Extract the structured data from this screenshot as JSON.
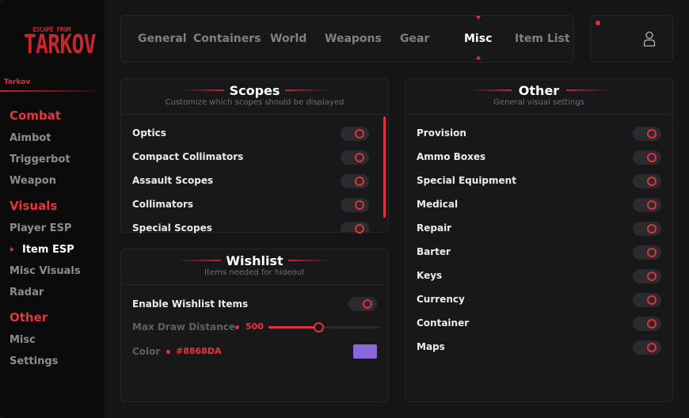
{
  "sidebar": {
    "logo_small": "ESCAPE FROM",
    "logo_big": "TARKOV",
    "game_label": "Tarkov",
    "items": [
      {
        "label": "Combat",
        "type": "heading"
      },
      {
        "label": "Aimbot",
        "type": "item"
      },
      {
        "label": "Triggerbot",
        "type": "item"
      },
      {
        "label": "Weapon",
        "type": "item"
      },
      {
        "label": "Visuals",
        "type": "heading"
      },
      {
        "label": "Player ESP",
        "type": "item"
      },
      {
        "label": "Item ESP",
        "type": "item",
        "active": true
      },
      {
        "label": "Misc Visuals",
        "type": "item"
      },
      {
        "label": "Radar",
        "type": "item"
      },
      {
        "label": "Other",
        "type": "heading"
      },
      {
        "label": "Misc",
        "type": "item"
      },
      {
        "label": "Settings",
        "type": "item"
      }
    ]
  },
  "tabs": [
    {
      "label": "General"
    },
    {
      "label": "Containers"
    },
    {
      "label": "World"
    },
    {
      "label": "Weapons"
    },
    {
      "label": "Gear"
    },
    {
      "label": "Misc",
      "active": true
    },
    {
      "label": "Item List"
    }
  ],
  "user": {
    "icon": "user-icon",
    "status_color": "#e0323a"
  },
  "scopes": {
    "title": "Scopes",
    "subtitle": "Customize which scopes should be displayed",
    "items": [
      {
        "label": "Optics",
        "enabled": true
      },
      {
        "label": "Compact Collimators",
        "enabled": true
      },
      {
        "label": "Assault Scopes",
        "enabled": true
      },
      {
        "label": "Collimators",
        "enabled": true
      },
      {
        "label": "Special Scopes",
        "enabled": true
      }
    ]
  },
  "wishlist": {
    "title": "Wishlist",
    "subtitle": "Items needed for hideout",
    "enable_label": "Enable Wishlist Items",
    "enable_on": true,
    "distance_label": "Max Draw Distance",
    "distance_value": "500",
    "distance_fraction": 0.45,
    "color_label": "Color",
    "color_value": "#8868DA",
    "color_hex": "#8868DA"
  },
  "other": {
    "title": "Other",
    "subtitle": "General visual settings",
    "items": [
      {
        "label": "Provision",
        "enabled": true
      },
      {
        "label": "Ammo Boxes",
        "enabled": true
      },
      {
        "label": "Special Equipment",
        "enabled": true
      },
      {
        "label": "Medical",
        "enabled": true
      },
      {
        "label": "Repair",
        "enabled": true
      },
      {
        "label": "Barter",
        "enabled": true
      },
      {
        "label": "Keys",
        "enabled": true
      },
      {
        "label": "Currency",
        "enabled": true
      },
      {
        "label": "Container",
        "enabled": true
      },
      {
        "label": "Maps",
        "enabled": true
      }
    ]
  },
  "colors": {
    "accent": "#e0323a",
    "background": "#151518",
    "sidebar": "#0b0b0c",
    "panel": "#18181b"
  }
}
